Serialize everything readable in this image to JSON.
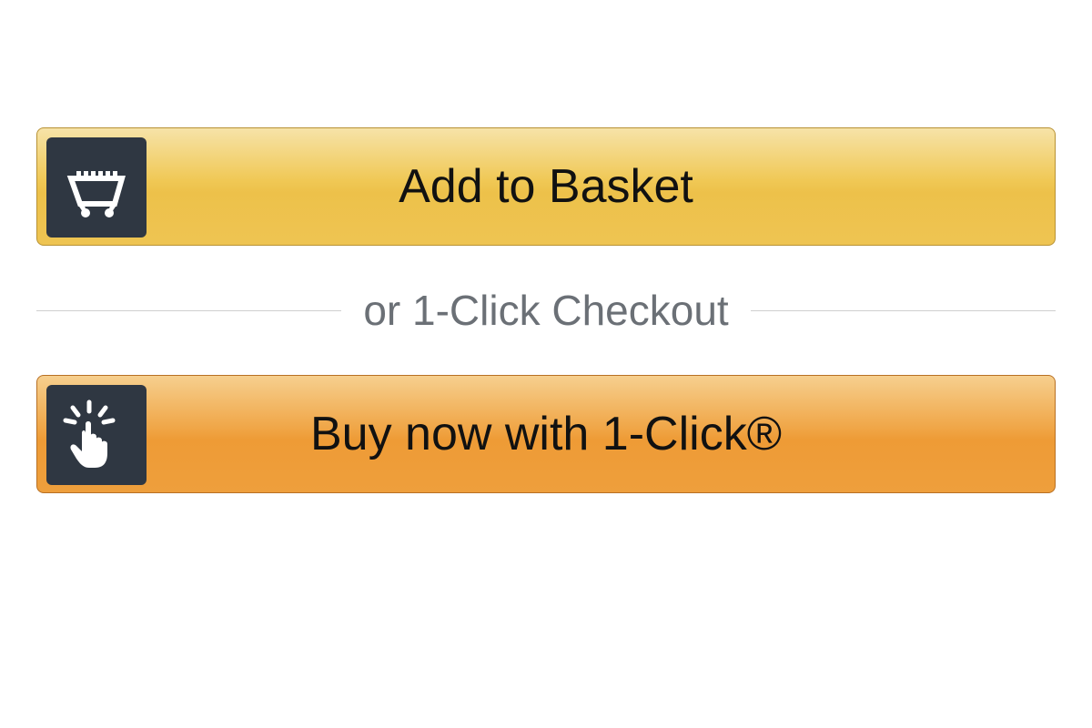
{
  "buttons": {
    "add_to_basket": {
      "label": "Add to Basket"
    },
    "buy_now": {
      "label": "Buy now with 1-Click®"
    }
  },
  "separator": {
    "text": "or 1-Click Checkout"
  }
}
